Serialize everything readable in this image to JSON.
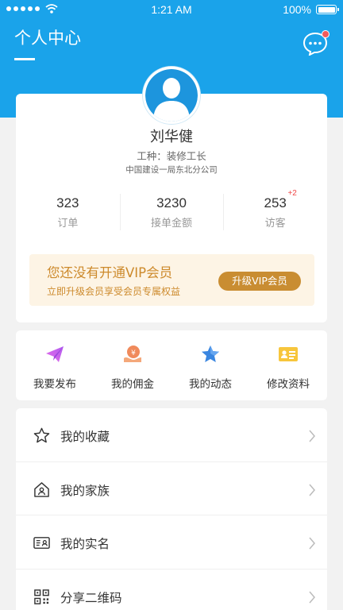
{
  "status_bar": {
    "time": "1:21 AM",
    "battery": "100%",
    "battery_level": 1.0
  },
  "header": {
    "title": "个人中心",
    "background_color": "#1aa3ea",
    "message_badge_color": "#f15b5b"
  },
  "profile": {
    "name": "刘华健",
    "role": "工种：装修工长",
    "company": "中国建设一局东北分公司",
    "stats": [
      {
        "value": "323",
        "label": "订单"
      },
      {
        "value": "3230",
        "label": "接单金额"
      },
      {
        "value": "253",
        "label": "访客",
        "increment": "+2"
      }
    ]
  },
  "vip": {
    "title": "您还没有开通VIP会员",
    "subtitle": "立即升级会员享受会员专属权益",
    "button_label": "升级VIP会员",
    "accent_color": "#c98d32"
  },
  "actions": [
    {
      "label": "我要发布",
      "icon": "paper-plane-icon"
    },
    {
      "label": "我的佣金",
      "icon": "commission-icon"
    },
    {
      "label": "我的动态",
      "icon": "star-icon"
    },
    {
      "label": "修改资料",
      "icon": "id-card-icon"
    }
  ],
  "menu": [
    {
      "label": "我的收藏",
      "icon": "star-outline-icon"
    },
    {
      "label": "我的家族",
      "icon": "home-icon"
    },
    {
      "label": "我的实名",
      "icon": "id-verify-icon"
    },
    {
      "label": "分享二维码",
      "icon": "qr-code-icon"
    }
  ]
}
